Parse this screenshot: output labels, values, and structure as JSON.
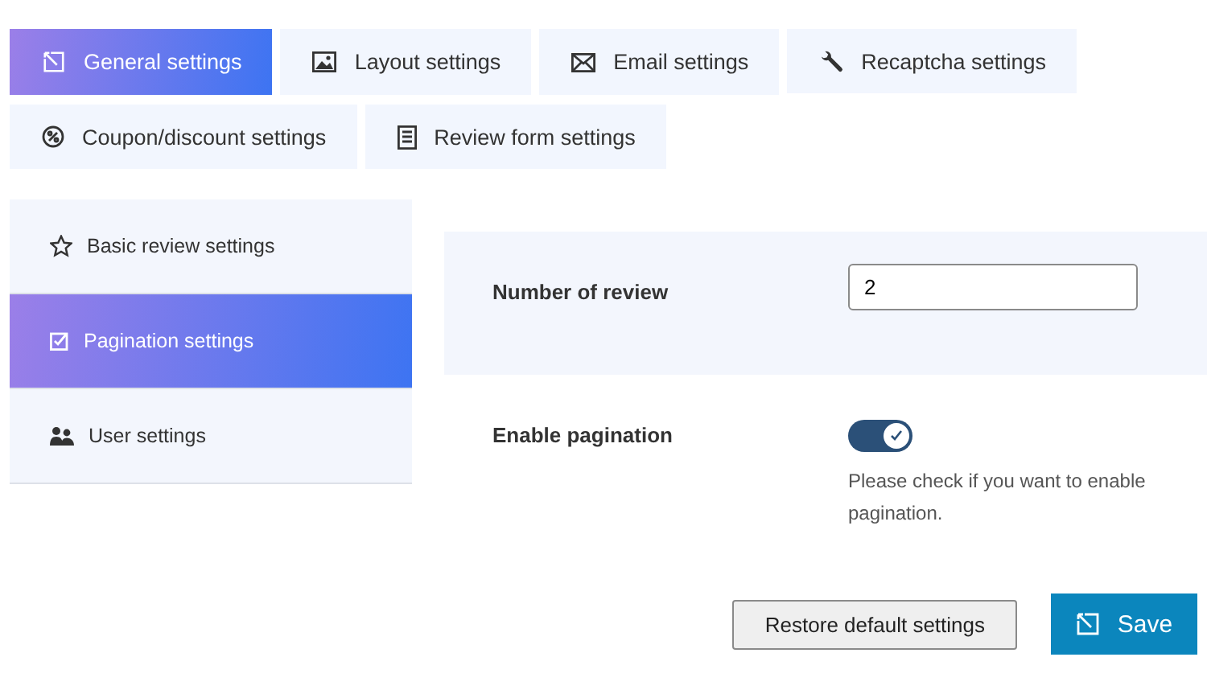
{
  "tabs": [
    {
      "label": "General settings",
      "selected": true
    },
    {
      "label": "Layout settings",
      "selected": false
    },
    {
      "label": "Email settings",
      "selected": false
    },
    {
      "label": "Recaptcha settings",
      "selected": false
    },
    {
      "label": "Coupon/discount settings",
      "selected": false
    },
    {
      "label": "Review form settings",
      "selected": false
    }
  ],
  "sidebar": {
    "items": [
      {
        "label": "Basic review settings",
        "selected": false
      },
      {
        "label": "Pagination settings",
        "selected": true
      },
      {
        "label": "User settings",
        "selected": false
      }
    ]
  },
  "settings": [
    {
      "kind": "number",
      "label": "Number of review",
      "value": "2"
    },
    {
      "kind": "toggle",
      "label": "Enable pagination",
      "on": true,
      "help": "Please check if you want to enable pagination."
    }
  ],
  "buttons": {
    "restore": "Restore default settings",
    "save": "Save"
  }
}
